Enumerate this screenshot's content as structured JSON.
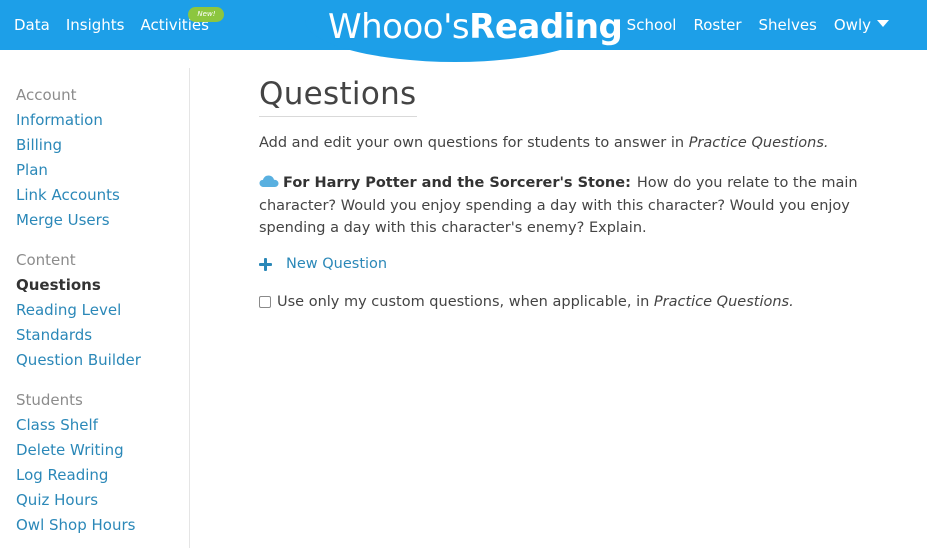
{
  "colors": {
    "nav_bg": "#1d9fe8",
    "link": "#2b88b8",
    "badge": "#8cc63f"
  },
  "nav": {
    "left": [
      "Data",
      "Insights",
      "Activities"
    ],
    "badge": "New!",
    "logo_thin": "Whooo's",
    "logo_bold": "Reading",
    "right": [
      "School",
      "Roster",
      "Shelves"
    ],
    "user": "Owly"
  },
  "sidebar": {
    "account": {
      "heading": "Account",
      "items": [
        "Information",
        "Billing",
        "Plan",
        "Link Accounts",
        "Merge Users"
      ]
    },
    "content": {
      "heading": "Content",
      "items": [
        "Questions",
        "Reading Level",
        "Standards",
        "Question Builder"
      ],
      "active": "Questions"
    },
    "students": {
      "heading": "Students",
      "items": [
        "Class Shelf",
        "Delete Writing",
        "Log Reading",
        "Quiz Hours",
        "Owl Shop Hours"
      ]
    }
  },
  "main": {
    "title": "Questions",
    "intro_text": "Add and edit your own questions for students to answer in ",
    "intro_em": "Practice Questions.",
    "question": {
      "icon": "cloud-icon",
      "book": "For Harry Potter and the Sorcerer's Stone:",
      "text": "How do you relate to the main character? Would you enjoy spending a day with this character? Would you enjoy spending a day with this character's enemy? Explain."
    },
    "new_question_label": "New Question",
    "option_text": "Use only my custom questions, when applicable, in ",
    "option_em": "Practice Questions.",
    "option_checked": false
  }
}
